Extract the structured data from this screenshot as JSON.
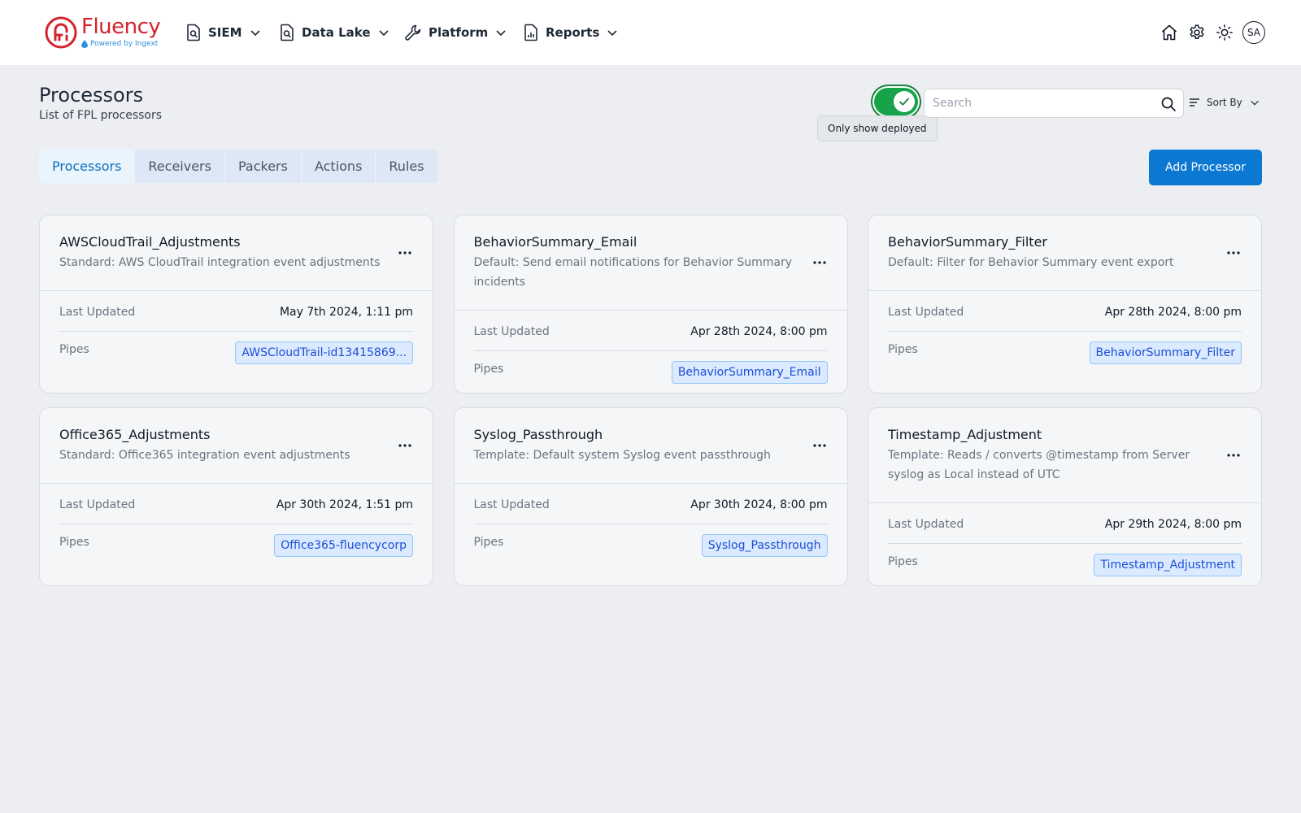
{
  "app": {
    "logo_name": "Fluency",
    "logo_sub": "Powered by Ingext"
  },
  "nav": {
    "items": [
      {
        "label": "SIEM",
        "icon": "search-document-icon"
      },
      {
        "label": "Data Lake",
        "icon": "search-document-icon"
      },
      {
        "label": "Platform",
        "icon": "wrench-icon"
      },
      {
        "label": "Reports",
        "icon": "report-document-icon"
      }
    ],
    "right_icons": [
      "home-icon",
      "gear-icon",
      "sun-icon"
    ],
    "avatar_initials": "SA"
  },
  "header": {
    "title": "Processors",
    "subtitle": "List of FPL processors",
    "toggle_on": true,
    "toggle_tooltip": "Only show deployed",
    "search_placeholder": "Search",
    "search_value": "",
    "sort_label": "Sort By"
  },
  "tabs": [
    {
      "label": "Processors",
      "active": true
    },
    {
      "label": "Receivers",
      "active": false
    },
    {
      "label": "Packers",
      "active": false
    },
    {
      "label": "Actions",
      "active": false
    },
    {
      "label": "Rules",
      "active": false
    }
  ],
  "add_button_label": "Add Processor",
  "labels": {
    "last_updated": "Last Updated",
    "pipes": "Pipes"
  },
  "cards": [
    {
      "name": "AWSCloudTrail_Adjustments",
      "description": "Standard: AWS CloudTrail integration event adjustments",
      "last_updated": "May 7th 2024, 1:11 pm",
      "pipe": "AWSCloudTrail-id13415869..."
    },
    {
      "name": "BehaviorSummary_Email",
      "description": "Default: Send email notifications for Behavior Summary incidents",
      "last_updated": "Apr 28th 2024, 8:00 pm",
      "pipe": "BehaviorSummary_Email"
    },
    {
      "name": "BehaviorSummary_Filter",
      "description": "Default: Filter for Behavior Summary event export",
      "last_updated": "Apr 28th 2024, 8:00 pm",
      "pipe": "BehaviorSummary_Filter"
    },
    {
      "name": "Office365_Adjustments",
      "description": "Standard: Office365 integration event adjustments",
      "last_updated": "Apr 30th 2024, 1:51 pm",
      "pipe": "Office365-fluencycorp"
    },
    {
      "name": "Syslog_Passthrough",
      "description": "Template: Default system Syslog event passthrough",
      "last_updated": "Apr 30th 2024, 8:00 pm",
      "pipe": "Syslog_Passthrough"
    },
    {
      "name": "Timestamp_Adjustment",
      "description": "Template: Reads / converts @timestamp from Server syslog as Local instead of UTC",
      "last_updated": "Apr 29th 2024, 8:00 pm",
      "pipe": "Timestamp_Adjustment"
    }
  ],
  "colors": {
    "brand_red": "#d3242c",
    "primary_blue": "#0b78d1",
    "toggle_green": "#16a34a",
    "pipe_tag_bg": "#dbeafe",
    "page_bg": "#eceef1"
  }
}
